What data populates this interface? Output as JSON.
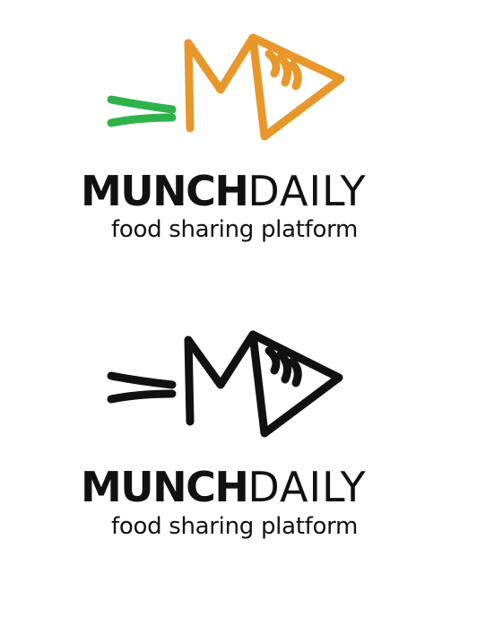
{
  "brand": {
    "name_bold": "MUNCH",
    "name_light": "DAILY",
    "tagline": "food sharing platform"
  },
  "colors": {
    "orange": "#E8972A",
    "green": "#2DB34A",
    "black": "#111111"
  },
  "variants": [
    {
      "name": "color"
    },
    {
      "name": "monochrome"
    }
  ]
}
